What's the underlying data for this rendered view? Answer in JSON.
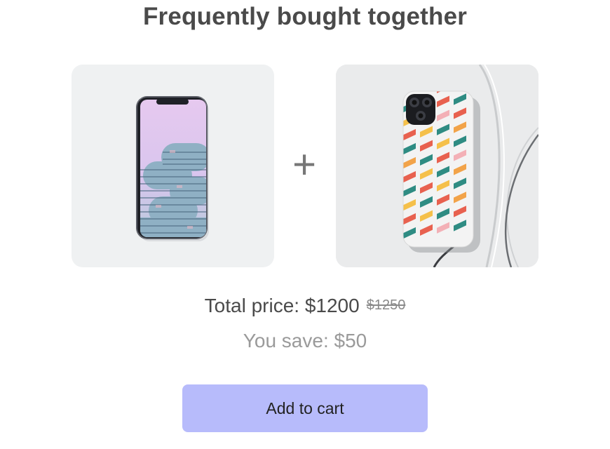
{
  "header": {
    "title": "Frequently bought together"
  },
  "products": [
    {
      "icon": "smartphone-image"
    },
    {
      "icon": "phone-case-image"
    }
  ],
  "plus_symbol": "+",
  "pricing": {
    "total_label": "Total price: $1200",
    "original_price": "$1250",
    "savings_label": "You save: $50"
  },
  "actions": {
    "add_to_cart_label": "Add to cart"
  },
  "colors": {
    "accent": "#b7bbfb",
    "text_dark": "#4a4a4a",
    "text_muted": "#9a9a9a"
  }
}
